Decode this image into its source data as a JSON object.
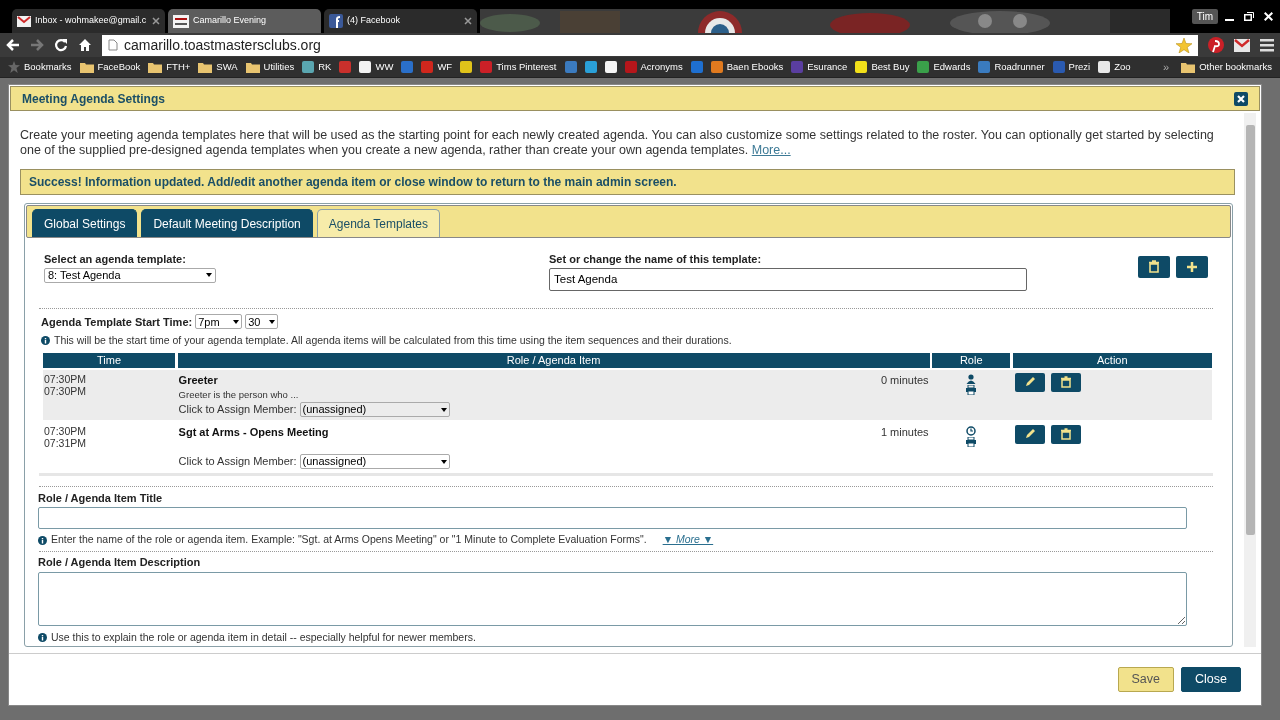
{
  "browser": {
    "tabs": [
      {
        "title": "Inbox - wohmakee@gmail.c",
        "kind": "mail",
        "selected": false,
        "closable": true
      },
      {
        "title": "Camarillo Evening",
        "kind": "fth",
        "selected": true,
        "closable": false
      },
      {
        "title": "(4) Facebook",
        "kind": "facebook",
        "selected": false,
        "closable": true
      }
    ],
    "user": "Tim",
    "address": "camarillo.toastmastersclubs.org",
    "bookmarks": [
      {
        "kind": "star",
        "label": "Bookmarks"
      },
      {
        "kind": "folder",
        "label": "FaceBook"
      },
      {
        "kind": "folder",
        "label": "FTH+"
      },
      {
        "kind": "folder",
        "label": "SWA"
      },
      {
        "kind": "folder",
        "label": "Utilities"
      },
      {
        "kind": "site",
        "color": "#5aa6b0",
        "label": "RK"
      },
      {
        "kind": "site",
        "color": "#c9302c"
      },
      {
        "kind": "site",
        "color": "#f2f2f2",
        "label": "WW"
      },
      {
        "kind": "site",
        "color": "#2a6fc9"
      },
      {
        "kind": "site",
        "color": "#d0271d",
        "label": "WF"
      },
      {
        "kind": "site",
        "color": "#e0c31a"
      },
      {
        "kind": "site",
        "color": "#cb2027",
        "label": "Tims Pinterest"
      },
      {
        "kind": "site",
        "color": "#3b7bbf"
      },
      {
        "kind": "site",
        "color": "#2aa0d8"
      },
      {
        "kind": "site",
        "color": "#f5f5f5"
      },
      {
        "kind": "site",
        "color": "#b5161b",
        "label": "Acronyms"
      },
      {
        "kind": "site",
        "color": "#1e6fd0"
      },
      {
        "kind": "site",
        "color": "#e07a1f",
        "label": "Baen Ebooks"
      },
      {
        "kind": "site",
        "color": "#5a3ea0",
        "label": "Esurance"
      },
      {
        "kind": "site",
        "color": "#f2e01a",
        "label": "Best Buy"
      },
      {
        "kind": "site",
        "color": "#3aa04a",
        "label": "Edwards"
      },
      {
        "kind": "site",
        "color": "#3a7bbf",
        "label": "Roadrunner"
      },
      {
        "kind": "site",
        "color": "#2a5ab0",
        "label": "Prezi"
      },
      {
        "kind": "site",
        "color": "#e8e8e8",
        "label": "Zoo"
      }
    ],
    "overflow": "»",
    "other_bookmarks": "Other bookmarks"
  },
  "dialog": {
    "title": "Meeting Agenda Settings",
    "intro": "Create your meeting agenda templates here that will be used as the starting point for each newly created agenda. You can also customize some settings related to the roster. You can optionally get started by selecting one of the supplied pre-designed agenda templates when you create a new agenda, rather than create your own agenda templates.",
    "intro_link": "More...",
    "success": "Success! Information updated. Add/edit another agenda item or close window to return to the main admin screen.",
    "tabs": [
      {
        "label": "Global Settings",
        "selected": false
      },
      {
        "label": "Default Meeting Description",
        "selected": false
      },
      {
        "label": "Agenda Templates",
        "selected": true
      }
    ],
    "template_select": {
      "label": "Select an agenda template:",
      "value": "8: Test Agenda"
    },
    "template_name": {
      "label": "Set or change the name of this template:",
      "value": "Test Agenda"
    },
    "start_time": {
      "label": "Agenda Template Start Time:",
      "hour": "7pm",
      "minute": "30",
      "info": "This will be the start time of your agenda template. All agenda items will be calculated from this time using the item sequences and their durations."
    },
    "table": {
      "columns": [
        "Time",
        "Role / Agenda Item",
        "Role",
        "Action"
      ],
      "rows": [
        {
          "start": "07:30PM",
          "end": "07:30PM",
          "title": "Greeter",
          "description": "Greeter is the person who ...",
          "duration": "0 minutes",
          "assign_label": "Click to Assign Member:",
          "member": "(unassigned)",
          "role_icons": [
            {
              "kind": "person"
            },
            {
              "kind": "printer"
            }
          ]
        },
        {
          "start": "07:30PM",
          "end": "07:31PM",
          "title": "Sgt at Arms - Opens Meeting",
          "duration": "1 minutes",
          "assign_label": "Click to Assign Member:",
          "member": "(unassigned)",
          "role_icons": [
            {
              "kind": "clock"
            },
            {
              "kind": "printer"
            }
          ]
        }
      ]
    },
    "item_title": {
      "label": "Role / Agenda Item Title",
      "info": "Enter the name of the role or agenda item. Example: \"Sgt. at Arms Opens Meeting\" or \"1 Minute to Complete Evaluation Forms\".",
      "more": "▼ More ▼"
    },
    "item_description": {
      "label": "Role / Agenda Item Description",
      "info": "Use this to explain the role or agenda item in detail -- especially helpful for newer members."
    },
    "buttons": [
      {
        "label": "Save",
        "kind": "highlight"
      },
      {
        "label": "Close",
        "kind": "primary"
      }
    ]
  }
}
